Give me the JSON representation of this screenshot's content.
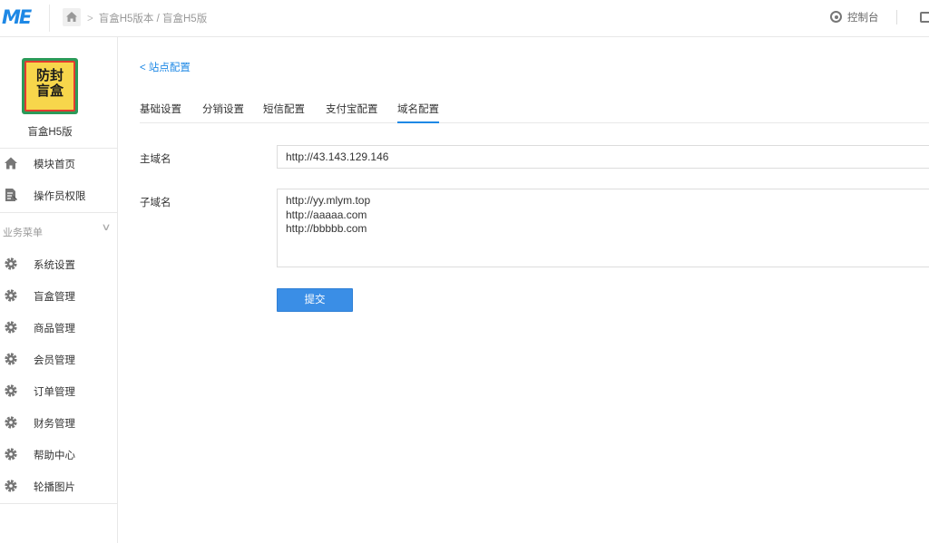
{
  "header": {
    "logo": "ME",
    "breadcrumb": "盲盒H5版本 / 盲盒H5版",
    "console_label": "控制台"
  },
  "sidebar": {
    "brand_logo_text": [
      "防封",
      "盲盒"
    ],
    "brand_name": "盲盒H5版",
    "top_items": [
      {
        "label": "模块首页",
        "icon": "home-icon"
      },
      {
        "label": "操作员权限",
        "icon": "edit-doc-icon"
      }
    ],
    "section_title": "业务菜单",
    "menu_items": [
      {
        "label": "系统设置",
        "icon": "gear-icon"
      },
      {
        "label": "盲盒管理",
        "icon": "gear-icon"
      },
      {
        "label": "商品管理",
        "icon": "gear-icon"
      },
      {
        "label": "会员管理",
        "icon": "gear-icon"
      },
      {
        "label": "订单管理",
        "icon": "gear-icon"
      },
      {
        "label": "财务管理",
        "icon": "gear-icon"
      },
      {
        "label": "帮助中心",
        "icon": "gear-icon"
      },
      {
        "label": "轮播图片",
        "icon": "gear-icon"
      }
    ]
  },
  "main": {
    "back_link": "站点配置",
    "tabs": [
      {
        "label": "基础设置",
        "active": false
      },
      {
        "label": "分销设置",
        "active": false
      },
      {
        "label": "短信配置",
        "active": false
      },
      {
        "label": "支付宝配置",
        "active": false
      },
      {
        "label": "域名配置",
        "active": true
      }
    ],
    "form": {
      "main_domain_label": "主域名",
      "main_domain_value": "http://43.143.129.146",
      "sub_domain_label": "子域名",
      "sub_domain_lines": [
        "http://yy.mlym.top",
        "http://aaaaa.com",
        "http://bbbbb.com"
      ],
      "submit_label": "提交"
    }
  },
  "colors": {
    "accent": "#1e88e5",
    "button": "#3a8ee6",
    "border": "#e8e8e8"
  }
}
